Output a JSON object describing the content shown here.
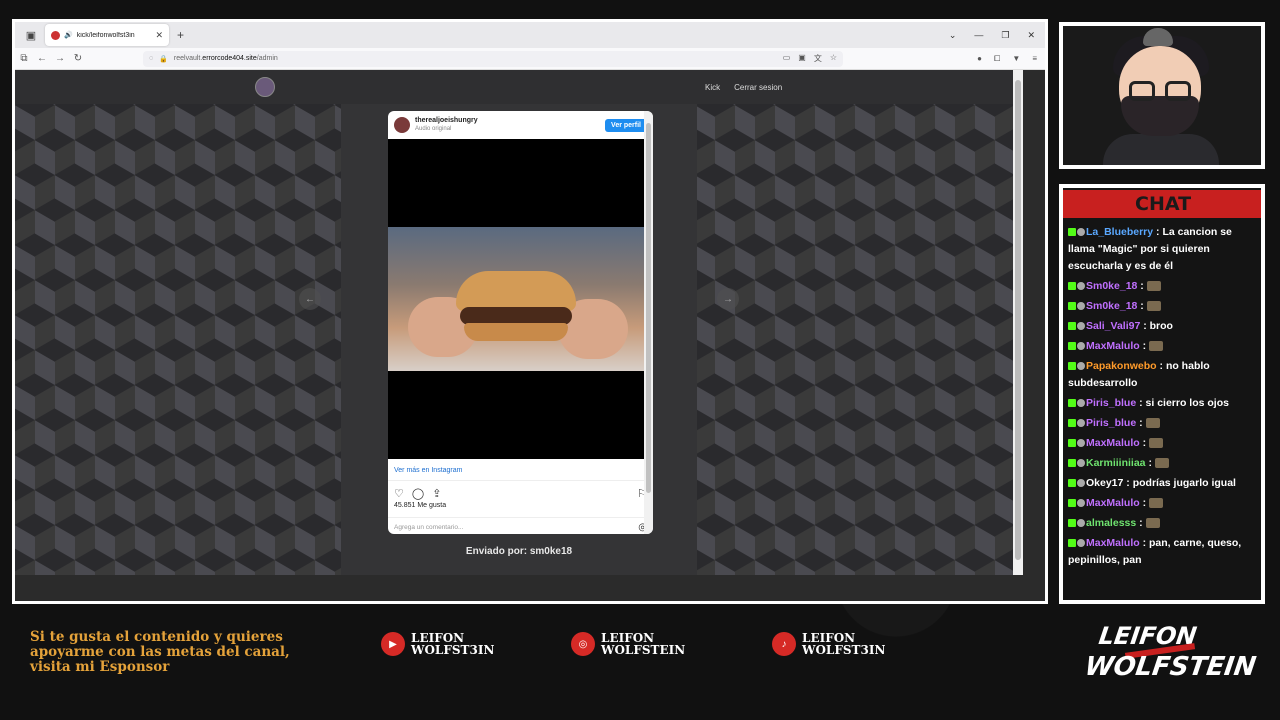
{
  "browser": {
    "tab_title": "kick/leifonwolfst3in",
    "url_prefix": "reelvault.",
    "url_domain": "errorcode404.site",
    "url_path": "/admin"
  },
  "site": {
    "nav": [
      "Kick",
      "Cerrar sesion"
    ],
    "sent_by": "Enviado por: sm0ke18"
  },
  "instagram": {
    "username": "therealjoeishungry",
    "audio": "Audio original",
    "follow_label": "Ver perfil",
    "more_label": "Ver más en Instagram",
    "likes": "45.851 Me gusta",
    "comment_placeholder": "Agrega un comentario..."
  },
  "chat": {
    "title": "CHAT",
    "messages": [
      {
        "user": "La_Blueberry",
        "text": ": La cancion se llama \"Magic\" por si quieren escucharla y es de él",
        "color": "#5aa8ff"
      },
      {
        "user": "Sm0ke_18",
        "text": ":",
        "color": "#c070ff"
      },
      {
        "user": "Sm0ke_18",
        "text": ":",
        "color": "#c070ff"
      },
      {
        "user": "Sali_Vali97",
        "text": ": broo",
        "color": "#c070ff"
      },
      {
        "user": "MaxMalulo",
        "text": ":",
        "color": "#c070ff"
      },
      {
        "user": "Papakonwebo",
        "text": ": no hablo subdesarrollo",
        "color": "#ff9b2a"
      },
      {
        "user": "Piris_blue",
        "text": ": si cierro los ojos",
        "color": "#c070ff"
      },
      {
        "user": "Piris_blue",
        "text": ":",
        "color": "#c070ff"
      },
      {
        "user": "MaxMalulo",
        "text": ":",
        "color": "#c070ff"
      },
      {
        "user": "Karmiiiniiaa",
        "text": ":",
        "color": "#6fe36f"
      },
      {
        "user": "Okey17",
        "text": ": podrías jugarlo igual",
        "color": "#ffffff"
      },
      {
        "user": "MaxMalulo",
        "text": ":",
        "color": "#c070ff"
      },
      {
        "user": "almalesss",
        "text": ":",
        "color": "#6fe36f"
      },
      {
        "user": "MaxMalulo",
        "text": ": pan, carne, queso, pepinillos, pan",
        "color": "#c070ff"
      }
    ]
  },
  "bottom": {
    "promo": "Si te gusta el contenido y quieres apoyarme con las metas del canal, visita mi Esponsor",
    "socials": [
      {
        "line1": "LEIFON",
        "line2": "WOLFST3IN",
        "icon": "youtube-icon"
      },
      {
        "line1": "LEIFON",
        "line2": "WOLFSTEIN",
        "icon": "instagram-icon"
      },
      {
        "line1": "LEIFON",
        "line2": "WOLFST3IN",
        "icon": "tiktok-icon"
      }
    ],
    "brand_line1": "LEIFON",
    "brand_line2": "WOLFSTEIN"
  },
  "colors": {
    "accent": "#c8201f",
    "promo": "#e4a23a",
    "kick": "#53fc18"
  }
}
